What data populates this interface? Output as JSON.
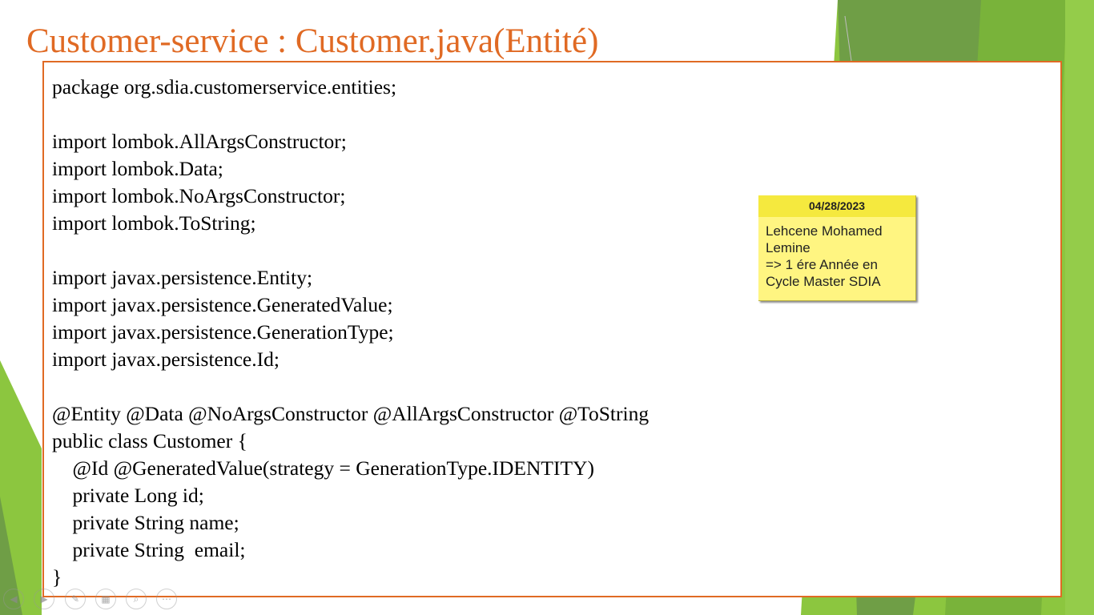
{
  "slide": {
    "title": "Customer-service : Customer.java(Entité)",
    "code_lines": [
      "package org.sdia.customerservice.entities;",
      "",
      "import lombok.AllArgsConstructor;",
      "import lombok.Data;",
      "import lombok.NoArgsConstructor;",
      "import lombok.ToString;",
      "",
      "import javax.persistence.Entity;",
      "import javax.persistence.GeneratedValue;",
      "import javax.persistence.GenerationType;",
      "import javax.persistence.Id;",
      "",
      "@Entity @Data @NoArgsConstructor @AllArgsConstructor @ToString",
      "public class Customer {",
      "    @Id @GeneratedValue(strategy = GenerationType.IDENTITY)",
      "    private Long id;",
      "    private String name;",
      "    private String  email;",
      "}"
    ]
  },
  "note": {
    "date": "04/28/2023",
    "lines": [
      "Lehcene Mohamed",
      "Lemine",
      "=> 1 ére Année en",
      "Cycle Master SDIA"
    ]
  },
  "colors": {
    "title": "#e06a24",
    "border": "#e06a24",
    "green_light": "#8cc63f",
    "green_dark": "#6a9a44",
    "note_bg": "#fff581",
    "note_header": "#f5e93e"
  },
  "slideshow_controls": [
    {
      "name": "previous-icon",
      "glyph": "◀"
    },
    {
      "name": "next-icon",
      "glyph": "▶"
    },
    {
      "name": "pen-icon",
      "glyph": "✎"
    },
    {
      "name": "slides-icon",
      "glyph": "▦"
    },
    {
      "name": "zoom-icon",
      "glyph": "⌕"
    },
    {
      "name": "more-icon",
      "glyph": "⋯"
    }
  ]
}
